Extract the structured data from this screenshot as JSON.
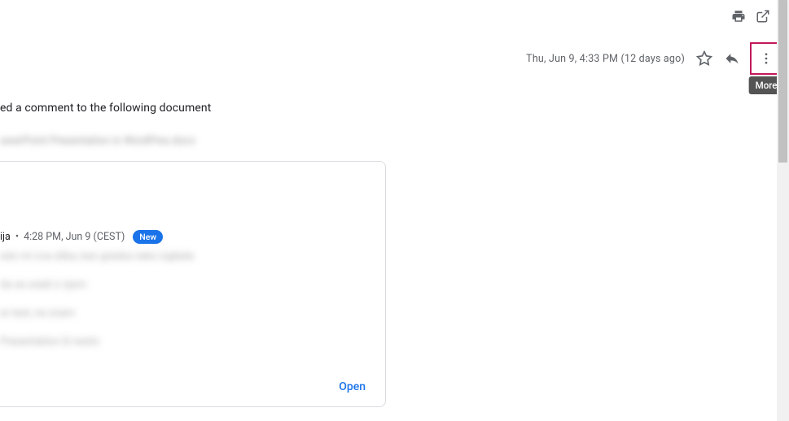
{
  "header": {
    "timestamp_text": "Thu, Jun 9, 4:33 PM (12 days ago)",
    "tooltip_more": "More"
  },
  "body": {
    "intro_fragment": "ed a comment to the following document",
    "doc_name_blur": "awerPoint Presentation in WordPres.docx"
  },
  "comment": {
    "author_fragment": "ija",
    "separator": "•",
    "time": "4:28 PM, Jun 9 (CEST)",
    "badge": "New",
    "lines": [
      "edo mi ova slika, kao greska neko izgleda",
      "da se uradi o njom",
      "ar test, ne znam",
      "Presentation ili nesto"
    ],
    "open_label": "Open"
  }
}
